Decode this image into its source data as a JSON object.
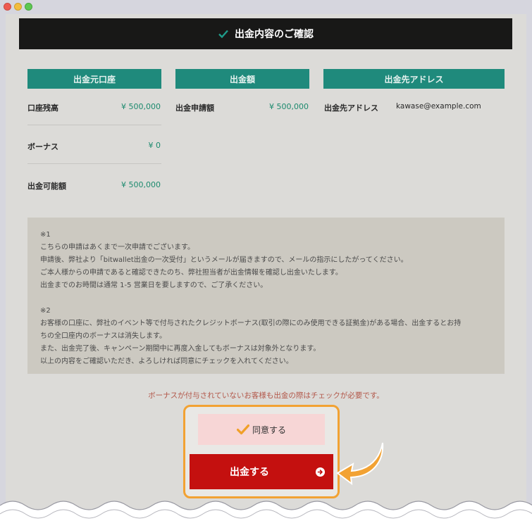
{
  "header": {
    "title": "出金内容のご確認"
  },
  "columns": [
    {
      "label": "出金元口座"
    },
    {
      "label": "出金額"
    },
    {
      "label": "出金先アドレス"
    }
  ],
  "account": {
    "balance_label": "口座残高",
    "balance_value": "¥ 500,000",
    "bonus_label": "ボーナス",
    "bonus_value": "¥ 0",
    "available_label": "出金可能額",
    "available_value": "¥ 500,000"
  },
  "amount": {
    "request_label": "出金申請額",
    "request_value": "¥ 500,000"
  },
  "address": {
    "label": "出金先アドレス",
    "value": "kawase@example.com"
  },
  "notice": {
    "text": "※1\nこちらの申請はあくまで一次申請でございます。\n申請後、弊社より「bitwallet出金の一次受付」というメールが届きますので、メールの指示にしたがってください。\nご本人様からの申請であると確認できたのち、弊社担当者が出金情報を確認し出金いたします。\n出金までのお時間は通常 1-5 営業日を要しますので、ご了承ください。\n\n※2\nお客様の口座に、弊社のイベント等で付与されたクレジットボーナス(取引の際にのみ使用できる証拠金)がある場合、出金するとお持\nちの全口座内のボーナスは消失します。\nまた、出金完了後、キャンペーン期間中に再度入金してもボーナスは対象外となります。\n以上の内容をご確認いただき、よろしければ同意にチェックを入れてください。"
  },
  "warning": {
    "text": "ボーナスが付与されていないお客様も出金の際はチェックが必要です。"
  },
  "agree": {
    "label": "同意する",
    "checked": true
  },
  "submit": {
    "label": "出金する"
  },
  "colors": {
    "accent": "#1f8a7c",
    "header_bg": "#181817",
    "button": "#c4100f",
    "highlight": "#f2a233"
  }
}
